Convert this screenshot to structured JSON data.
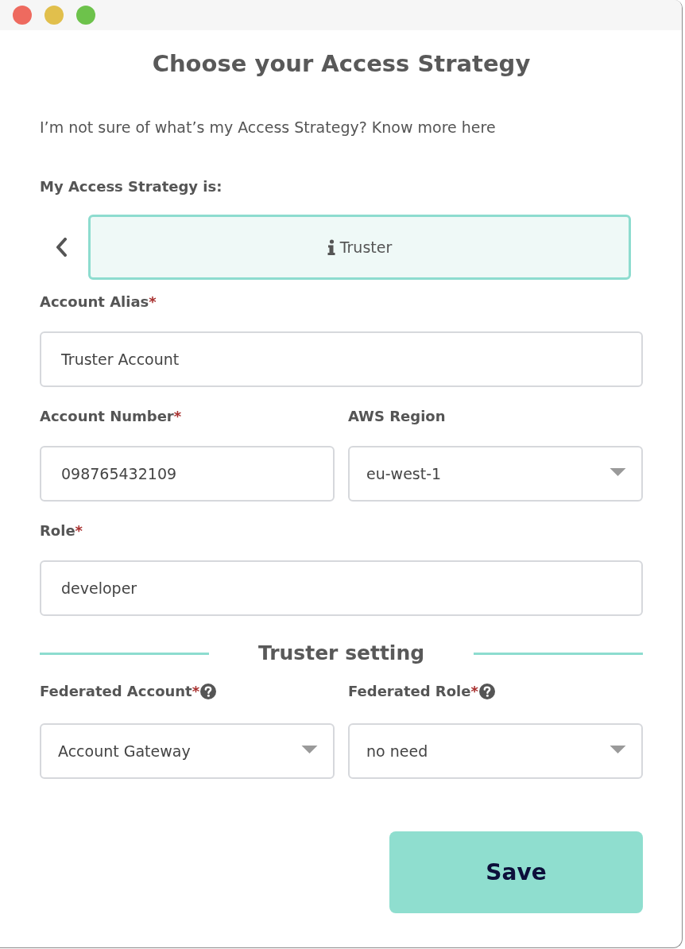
{
  "window": {
    "controls": [
      {
        "color": "#ee6a5f"
      },
      {
        "color": "#e1bf4c"
      },
      {
        "color": "#6dc24b"
      }
    ]
  },
  "title": "Choose your Access Strategy",
  "help_text": "I’m not sure of what’s my Access Strategy? Know more here",
  "strategy": {
    "label": "My Access Strategy is:",
    "value": "Truster"
  },
  "rows": [
    {
      "fields": [
        {
          "kind": "text",
          "label": "Account Alias",
          "required_mark": "*",
          "value": "Truster Account"
        }
      ]
    },
    {
      "fields": [
        {
          "kind": "text",
          "label": "Account Number",
          "required_mark": "*",
          "value": "098765432109"
        },
        {
          "kind": "select",
          "label": "AWS Region",
          "value": "eu-west-1"
        }
      ]
    },
    {
      "fields": [
        {
          "kind": "text",
          "label": "Role",
          "required_mark": "*",
          "value": "developer"
        }
      ]
    }
  ],
  "section": {
    "title": "Truster setting",
    "rows": [
      {
        "fields": [
          {
            "kind": "select",
            "label": "Federated Account",
            "required_mark": "*",
            "help": true,
            "value": "Account Gateway"
          },
          {
            "kind": "select",
            "label": "Federated Role",
            "required_mark": "*",
            "help": true,
            "value": "no need"
          }
        ]
      }
    ]
  },
  "save_button": {
    "label": "Save"
  }
}
